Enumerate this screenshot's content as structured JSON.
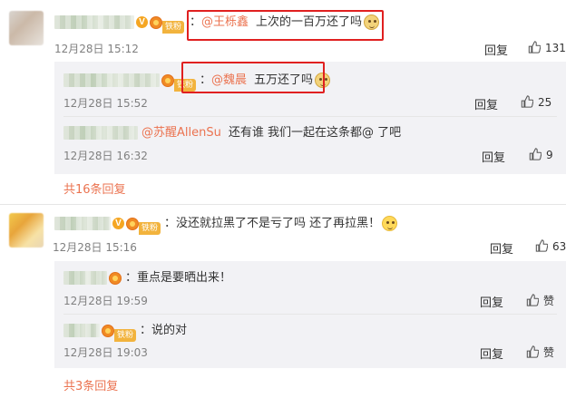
{
  "comments": [
    {
      "text": "：",
      "mention": "@王栎鑫",
      "body": "上次的一百万还了吗",
      "emoji": "doge-emoji",
      "fan_badge": "铁粉",
      "time": "12月28日 15:12",
      "reply_label": "回复",
      "likes": "131",
      "replies": [
        {
          "mention": "@魏晨",
          "body": "五万还了吗",
          "fan_badge": "铁粉",
          "time": "12月28日 15:52",
          "reply_label": "回复",
          "likes": "25"
        },
        {
          "mention": "@苏醒AllenSu",
          "body": "还有谁 我们一起在这条都@ 了吧",
          "time": "12月28日 16:32",
          "reply_label": "回复",
          "likes": "9"
        }
      ],
      "more_replies": "共16条回复"
    },
    {
      "text": "：没还就拉黑了不是亏了吗 还了再拉黑！",
      "emoji": "thinking-emoji",
      "fan_badge": "铁粉",
      "time": "12月28日 15:16",
      "reply_label": "回复",
      "likes": "63",
      "replies": [
        {
          "body": "：重点是要晒出来！",
          "time": "12月28日 19:59",
          "reply_label": "回复",
          "likes": "赞"
        },
        {
          "body": "：说的对",
          "fan_badge": "铁粉",
          "time": "12月28日 19:03",
          "reply_label": "回复",
          "likes": "赞"
        }
      ],
      "more_replies": "共3条回复"
    }
  ],
  "colors": {
    "mention": "#eb7350",
    "highlight": "#e02020",
    "subbox": "#f2f2f5",
    "badge": "#f5a623"
  }
}
